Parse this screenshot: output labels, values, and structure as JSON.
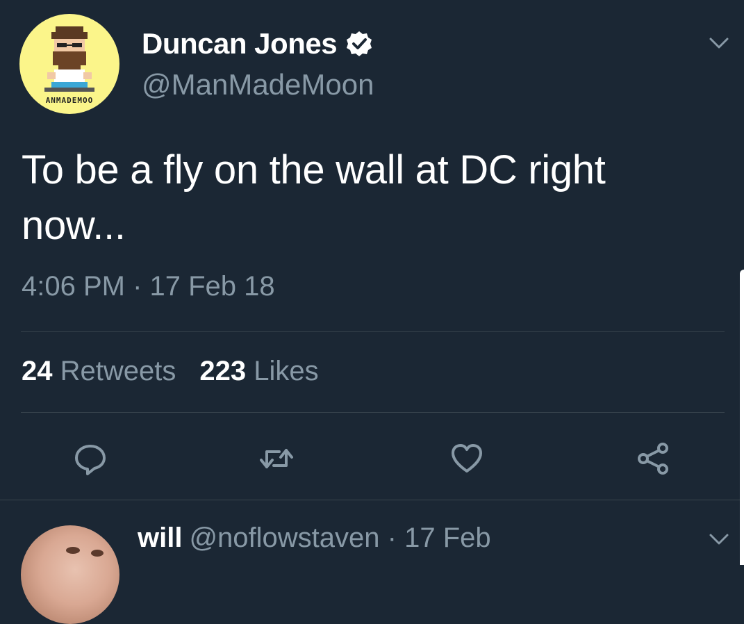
{
  "tweet": {
    "author": {
      "display_name": "Duncan Jones",
      "handle": "@ManMadeMoon",
      "verified": true,
      "avatar_caption": "ANMADEMOO"
    },
    "text": "To be a fly on the wall at DC right now...",
    "timestamp": "4:06 PM · 17 Feb 18",
    "stats": {
      "retweets_count": "24",
      "retweets_label": "Retweets",
      "likes_count": "223",
      "likes_label": "Likes"
    },
    "actions": [
      "reply-icon",
      "retweet-icon",
      "like-icon",
      "share-icon"
    ]
  },
  "reply": {
    "display_name": "will",
    "meta": "@noflowstaven · 17 Feb"
  },
  "colors": {
    "background": "#1b2734",
    "primary_text": "#ffffff",
    "secondary_text": "#8899a6",
    "divider": "#38444d",
    "avatar_bg": "#fbf58a"
  }
}
